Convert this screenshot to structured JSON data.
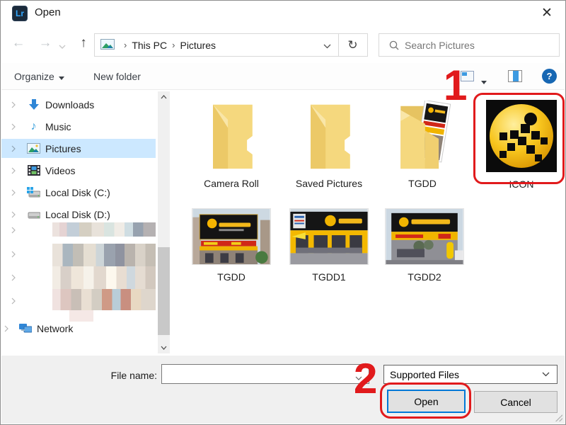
{
  "window": {
    "app_badge": "Lr",
    "title": "Open",
    "close_glyph": "✕"
  },
  "nav": {
    "back_glyph": "←",
    "forward_glyph": "→",
    "up_glyph": "↑",
    "refresh_glyph": "↻",
    "breadcrumb": {
      "root": "This PC",
      "sep": "›",
      "current": "Pictures"
    },
    "search_placeholder": "Search Pictures"
  },
  "toolbar": {
    "organize": "Organize",
    "new_folder": "New folder",
    "help_glyph": "?"
  },
  "sidebar": {
    "items": [
      {
        "label": "Downloads"
      },
      {
        "label": "Music"
      },
      {
        "label": "Pictures",
        "selected": true
      },
      {
        "label": "Videos"
      },
      {
        "label": "Local Disk (C:)"
      },
      {
        "label": "Local Disk (D:)"
      },
      {
        "label": "Network"
      }
    ]
  },
  "files": {
    "row1": [
      {
        "name": "Camera Roll",
        "type": "folder"
      },
      {
        "name": "Saved Pictures",
        "type": "folder"
      },
      {
        "name": "TGDD",
        "type": "folder-with-images"
      },
      {
        "name": "ICON",
        "type": "image-file"
      }
    ],
    "row2": [
      {
        "name": "TGDD",
        "type": "image-file"
      },
      {
        "name": "TGDD1",
        "type": "image-file"
      },
      {
        "name": "TGDD2",
        "type": "image-file"
      }
    ]
  },
  "footer": {
    "file_name_label": "File name:",
    "file_name_value": "",
    "filter_value": "Supported Files",
    "open_label": "Open",
    "cancel_label": "Cancel"
  },
  "annotations": {
    "step1": "1",
    "step2": "2",
    "highlight_color": "#e11a1c"
  },
  "colors": {
    "selection": "#cce8ff",
    "accent_blue": "#0078d7",
    "folder_yellow": "#f5d87e"
  }
}
